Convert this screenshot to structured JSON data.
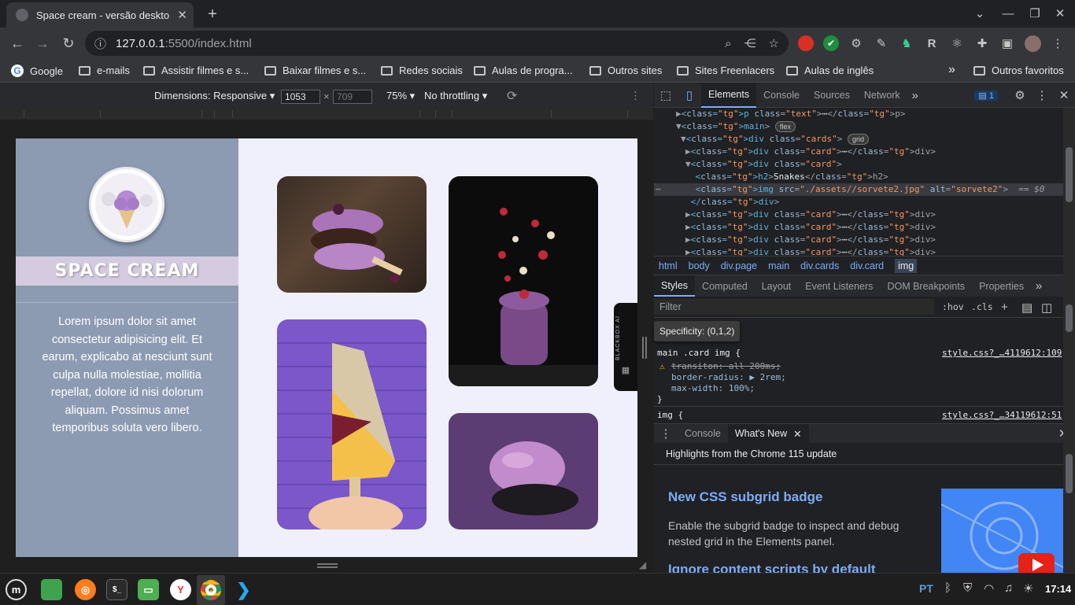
{
  "browser": {
    "tab_title": "Space cream - versão desktop",
    "url_host": "127.0.0.1",
    "url_path": ":5500/index.html",
    "bookmarks": [
      "Google",
      "e-mails",
      "Assistir filmes e s...",
      "Baixar filmes e s...",
      "Redes sociais",
      "Aulas de progra...",
      "Outros sites",
      "Sites Freenlacers",
      "Aulas de inglês"
    ],
    "other_bookmarks": "Outros favoritos",
    "more_bookmarks": "»"
  },
  "device_toolbar": {
    "dimensions_label": "Dimensions: Responsive",
    "width": "1053",
    "times": "×",
    "height_placeholder": "709",
    "zoom": "75%",
    "throttle": "No throttling"
  },
  "page": {
    "brand": "SPACE CREAM",
    "lorem": "Lorem ipsum dolor sit amet consectetur adipisicing elit. Et earum, explicabo at nesciunt sunt culpa nulla molestiae, mollitia repellat, dolore id nisi dolorum aliquam. Possimus amet temporibus soluta vero libero.",
    "sidebar_extension": "BLACKBOX AI"
  },
  "devtools": {
    "tabs": [
      "Elements",
      "Console",
      "Sources",
      "Network"
    ],
    "issues_count": "1",
    "elements_lines": [
      {
        "indent": 4,
        "arrow": "▶",
        "html": "<p class=\"text\">⋯</p>"
      },
      {
        "indent": 4,
        "arrow": "▼",
        "html": "<main>",
        "badge": "flex"
      },
      {
        "indent": 5,
        "arrow": "▼",
        "html": "<div class=\"cards\">",
        "badge": "grid"
      },
      {
        "indent": 6,
        "arrow": "▶",
        "html": "<div class=\"card\">⋯</div>"
      },
      {
        "indent": 6,
        "arrow": "▼",
        "html": "<div class=\"card\">"
      },
      {
        "indent": 7,
        "arrow": "",
        "html": "<h2>Snakes</h2>"
      },
      {
        "indent": 7,
        "arrow": "",
        "html": "<img src=\"./assets//sorvete2.jpg\" alt=\"sorvete2\"> == $0",
        "selected": true
      },
      {
        "indent": 6,
        "arrow": "",
        "html": "</div>"
      },
      {
        "indent": 6,
        "arrow": "▶",
        "html": "<div class=\"card\">⋯</div>"
      },
      {
        "indent": 6,
        "arrow": "▶",
        "html": "<div class=\"card\">⋯</div>"
      },
      {
        "indent": 6,
        "arrow": "▶",
        "html": "<div class=\"card\">⋯</div>"
      },
      {
        "indent": 6,
        "arrow": "▶",
        "html": "<div class=\"card\">⋯</div>"
      }
    ],
    "breadcrumbs": [
      "html",
      "body",
      "div.page",
      "main",
      "div.cards",
      "div.card",
      "img"
    ],
    "styles_tabs": [
      "Styles",
      "Computed",
      "Layout",
      "Event Listeners",
      "DOM Breakpoints",
      "Properties"
    ],
    "filter_placeholder": "Filter",
    "hov": ":hov",
    "cls": ".cls",
    "specificity": "Specificity: (0,1,2)",
    "rule1_selector": "main .card img {",
    "rule1_source": "style.css?_…4119612:109",
    "rule1_props": [
      "transiton: all 200ms;",
      "border-radius: ▶ 2rem;",
      "max-width: 100%;"
    ],
    "rule_close": "}",
    "rule2_selector": "img {",
    "rule2_source": "style.css?_…34119612:51",
    "drawer_tabs": [
      "Console",
      "What's New"
    ],
    "whatsnew_header": "Highlights from the Chrome 115 update",
    "whatsnew_title": "New CSS subgrid badge",
    "whatsnew_desc": "Enable the subgrid badge to inspect and debug nested grid in the Elements panel.",
    "whatsnew_next": "Ignore content scripts by default"
  },
  "taskbar": {
    "lang": "PT",
    "time": "17:14"
  }
}
